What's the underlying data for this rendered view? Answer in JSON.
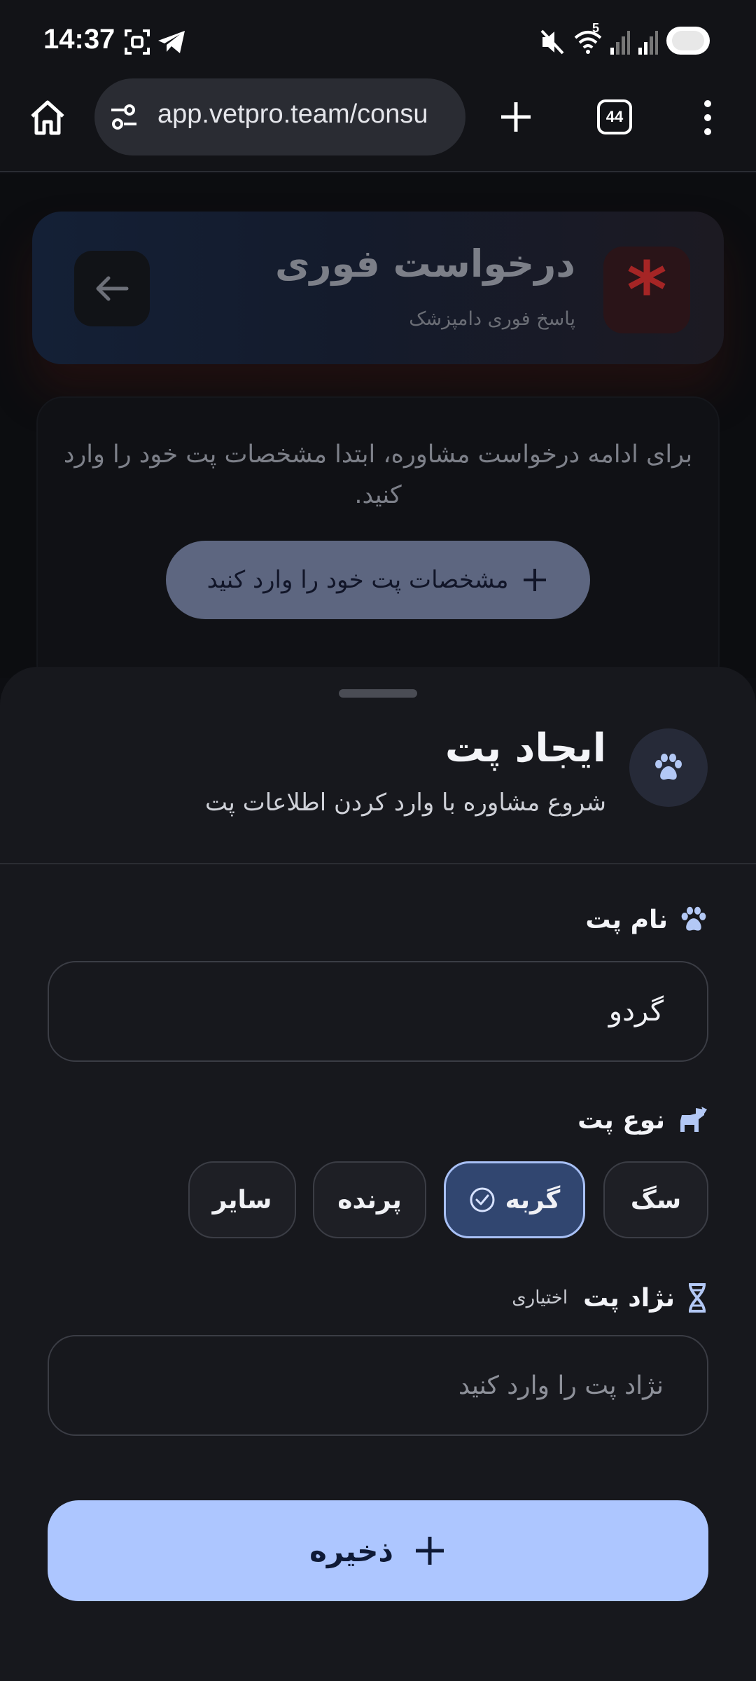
{
  "status_bar": {
    "time": "14:37",
    "icons": [
      "screenshot-icon",
      "telegram-icon",
      "mute-icon",
      "wifi-icon",
      "signal-icon",
      "signal-icon",
      "battery-icon"
    ],
    "wifi_badge": "5"
  },
  "browser": {
    "url": "app.vetpro.team/consu",
    "tab_count": "44",
    "icons": [
      "home-icon",
      "site-settings-icon",
      "new-tab-icon",
      "menu-icon"
    ]
  },
  "hero": {
    "title": "درخواست فوری",
    "subtitle": "پاسخ فوری دامپزشک",
    "badge": "*"
  },
  "info": {
    "message": "برای ادامه درخواست مشاوره، ابتدا مشخصات پت خود را وارد کنید.",
    "add_pet_label": "مشخصات پت خود را وارد کنید"
  },
  "sheet": {
    "title": "ایجاد پت",
    "subtitle": "شروع مشاوره با وارد کردن اطلاعات پت",
    "pet_name_label": "نام پت",
    "pet_name_value": "گردو",
    "pet_type_label": "نوع پت",
    "pet_types": [
      "سگ",
      "گربه",
      "پرنده",
      "سایر"
    ],
    "pet_type_selected": "گربه",
    "breed_label": "نژاد پت",
    "breed_optional": "اختیاری",
    "breed_placeholder": "نژاد پت را وارد کنید",
    "save_label": "ذخیره"
  },
  "colors": {
    "accent": "#adc6ff",
    "selected_chip": "#314670",
    "urgent": "#a52525"
  }
}
